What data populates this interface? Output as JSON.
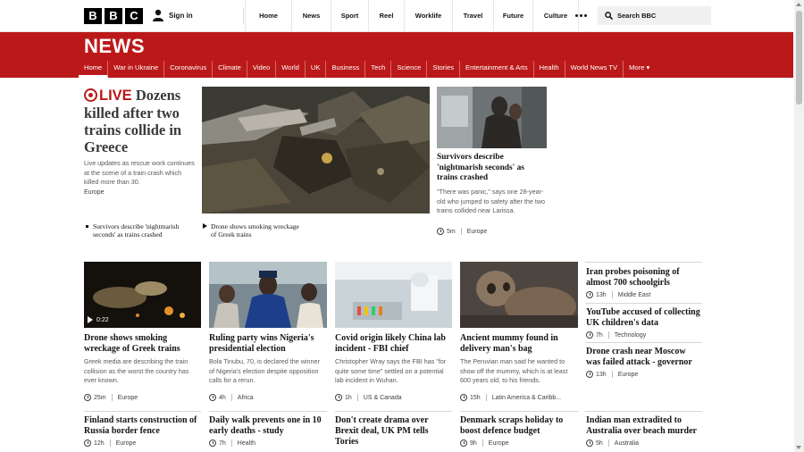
{
  "top": {
    "logo_letters": [
      "B",
      "B",
      "C"
    ],
    "signin": "Sign in",
    "nav": [
      "Home",
      "News",
      "Sport",
      "Reel",
      "Worklife",
      "Travel",
      "Future",
      "Culture"
    ],
    "search_placeholder": "Search BBC"
  },
  "header": {
    "title": "NEWS",
    "nav": [
      "Home",
      "War in Ukraine",
      "Coronavirus",
      "Climate",
      "Video",
      "World",
      "UK",
      "Business",
      "Tech",
      "Science",
      "Stories",
      "Entertainment & Arts",
      "Health",
      "World News TV",
      "More ▾"
    ],
    "active": "Home"
  },
  "lead": {
    "live_label": "LIVE",
    "title": "Dozens killed after two trains collide in Greece",
    "summary": "Live updates as rescue work continues at the scene of a train crash which killed more than 30.",
    "tag": "Europe",
    "related": [
      "Survivors describe 'nightmarish seconds' as trains crashed",
      "Drone shows smoking wreckage of Greek trains"
    ]
  },
  "side_story": {
    "title": "Survivors describe 'nightmarish seconds' as trains crashed",
    "summary": "\"There was panic,\" says one 28-year-old who jumped to safety after the two trains collided near Larissa.",
    "time": "5m",
    "tag": "Europe"
  },
  "row1": [
    {
      "title": "Drone shows smoking wreckage of Greek trains",
      "summary": "Greek media are describing the train collision as the worst the country has ever known.",
      "time": "25m",
      "tag": "Europe",
      "video_duration": "0:22"
    },
    {
      "title": "Ruling party wins Nigeria's presidential election",
      "summary": "Bola Tinubu, 70, is declared the winner of Nigeria's election despite opposition calls for a rerun.",
      "time": "4h",
      "tag": "Africa"
    },
    {
      "title": "Covid origin likely China lab incident - FBI chief",
      "summary": "Christopher Wray says the FBI has \"for quite some time\" settled on a potential lab incident in Wuhan.",
      "time": "1h",
      "tag": "US & Canada"
    },
    {
      "title": "Ancient mummy found in delivery man's bag",
      "summary": "The Peruvian man said he wanted to show off the mummy, which is at least 600 years old, to his friends.",
      "time": "15h",
      "tag": "Latin America & Caribb..."
    }
  ],
  "right_column": [
    {
      "title": "Iran probes poisoning of almost 700 schoolgirls",
      "time": "13h",
      "tag": "Middle East"
    },
    {
      "title": "YouTube accused of collecting UK children's data",
      "time": "7h",
      "tag": "Technology"
    },
    {
      "title": "Drone crash near Moscow was failed attack - governor",
      "time": "13h",
      "tag": "Europe"
    }
  ],
  "row2": [
    {
      "title": "Finland starts construction of Russia border fence",
      "time": "12h",
      "tag": "Europe"
    },
    {
      "title": "Daily walk prevents one in 10 early deaths - study",
      "time": "7h",
      "tag": "Health"
    },
    {
      "title": "Don't create drama over Brexit deal, UK PM tells Tories",
      "time": "",
      "tag": ""
    },
    {
      "title": "Denmark scraps holiday to boost defence budget",
      "time": "9h",
      "tag": "Europe"
    },
    {
      "title": "Indian man extradited to Australia over beach murder",
      "time": "5h",
      "tag": "Australia"
    }
  ]
}
